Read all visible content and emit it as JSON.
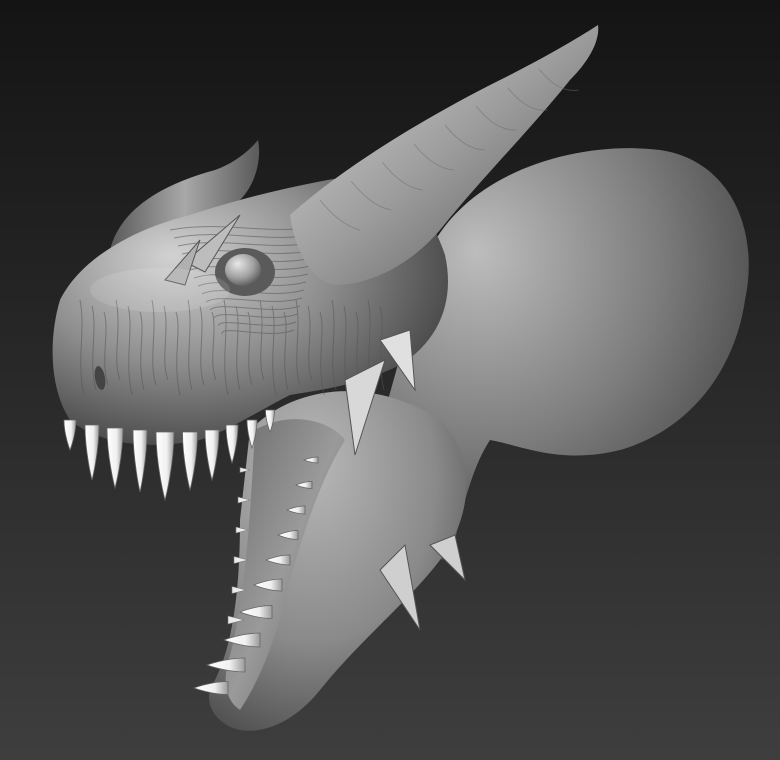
{
  "scene": {
    "subject": "dragon-head-sculpt",
    "render_style": "grey-clay-matcap",
    "colors": {
      "background_top": "#141414",
      "background_bottom": "#3e3e3e",
      "clay_light": "#d2d2d2",
      "clay_mid": "#8e8e8e",
      "clay_dark": "#3a3a3a",
      "mouth_interior": "#9a9a9a",
      "teeth": "#f0f0f0"
    }
  }
}
